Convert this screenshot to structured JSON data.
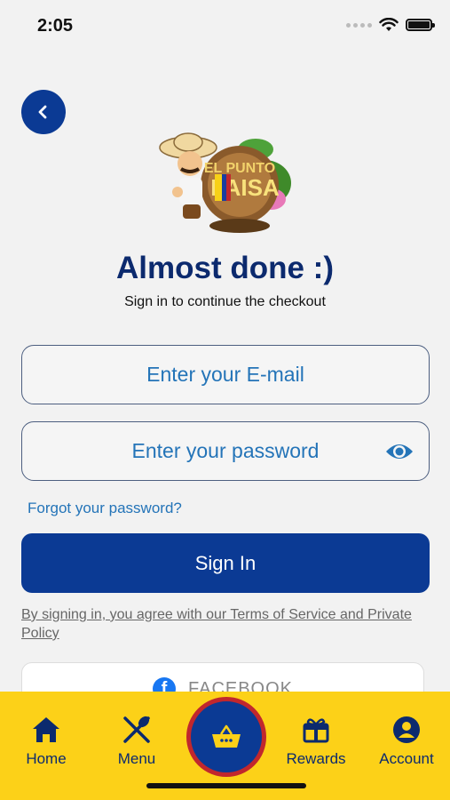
{
  "status_bar": {
    "time": "2:05"
  },
  "header": {
    "title": "Almost done :)",
    "subtitle": "Sign in to continue the checkout"
  },
  "form": {
    "email_placeholder": "Enter your E-mail",
    "email_value": "",
    "password_placeholder": "Enter your password",
    "password_value": "",
    "forgot_label": "Forgot your password?",
    "signin_label": "Sign In",
    "terms_text": "By signing in, you agree with our Terms of Service and Private Policy"
  },
  "social": {
    "facebook_label": "FACEBOOK"
  },
  "tab_bar": {
    "items": [
      {
        "label": "Home",
        "icon": "home-icon"
      },
      {
        "label": "Menu",
        "icon": "utensils-icon"
      },
      {
        "label": "",
        "icon": "basket-icon"
      },
      {
        "label": "Rewards",
        "icon": "gift-icon"
      },
      {
        "label": "Account",
        "icon": "account-icon"
      }
    ]
  },
  "colors": {
    "primary": "#0b3a94",
    "title": "#0c2a6e",
    "link": "#2474b8",
    "tab_bar": "#fcd118",
    "cart_ring": "#c1272d",
    "background": "#f2f2f2"
  }
}
